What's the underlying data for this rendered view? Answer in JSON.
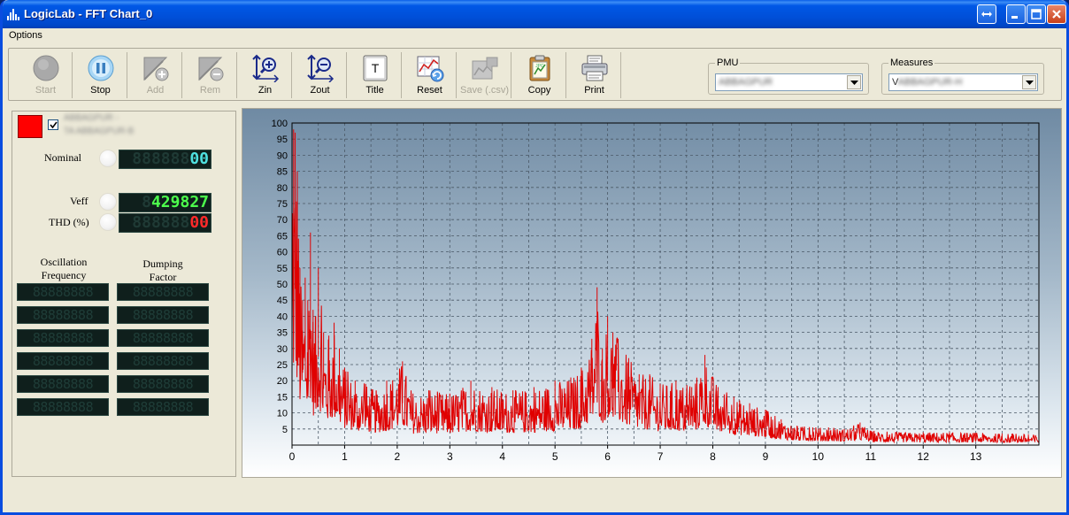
{
  "window": {
    "title": "LogicLab - FFT Chart_0"
  },
  "menu": {
    "options": "Options"
  },
  "toolbar": {
    "buttons": [
      {
        "label": "Start",
        "icon": "start-icon",
        "enabled": false
      },
      {
        "label": "Stop",
        "icon": "stop-icon",
        "enabled": true
      },
      {
        "label": "Add",
        "icon": "add-icon",
        "enabled": false
      },
      {
        "label": "Rem",
        "icon": "remove-icon",
        "enabled": false
      },
      {
        "label": "Zin",
        "icon": "zoom-in-icon",
        "enabled": true
      },
      {
        "label": "Zout",
        "icon": "zoom-out-icon",
        "enabled": true
      },
      {
        "label": "Title",
        "icon": "title-icon",
        "enabled": true
      },
      {
        "label": "Reset",
        "icon": "reset-icon",
        "enabled": true
      },
      {
        "label": "Save (.csv)",
        "icon": "save-csv-icon",
        "enabled": false
      },
      {
        "label": "Copy",
        "icon": "copy-icon",
        "enabled": true
      },
      {
        "label": "Print",
        "icon": "print-icon",
        "enabled": true
      }
    ],
    "pmu": {
      "label": "PMU",
      "value": "ABBAGPUR"
    },
    "measures": {
      "label": "Measures",
      "value_prefix": "V",
      "value_blurred": "ABBAGPUR-H"
    }
  },
  "left_panel": {
    "series_color": "#ff0000",
    "series_checked": true,
    "series_name_line1": "ABBAGPUR -",
    "series_name_line2": "TA ABBAGPUR-B",
    "nominal": {
      "label": "Nominal",
      "ghost": "888888",
      "value": "00"
    },
    "veff": {
      "label": "Veff",
      "ghost": "8",
      "value": "429827"
    },
    "thd": {
      "label": "THD (%)",
      "ghost": "888888",
      "value": "00"
    },
    "oscillation_header": "Oscillation Frequency",
    "damping_header": "Dumping Factor",
    "cell_placeholder": "88888888",
    "rows": 6
  },
  "colors": {
    "series": "#e00000",
    "lcd_cyan": "#4fe0e0",
    "lcd_green": "#4dff4d",
    "lcd_red": "#ff2a2a"
  },
  "chart_data": {
    "type": "line",
    "xlim": [
      0,
      14.2
    ],
    "ylim": [
      0,
      100
    ],
    "x_ticks": [
      0,
      1,
      2,
      3,
      4,
      5,
      6,
      7,
      8,
      9,
      10,
      11,
      12,
      13
    ],
    "y_ticks": [
      5,
      10,
      15,
      20,
      25,
      30,
      35,
      40,
      45,
      50,
      55,
      60,
      65,
      70,
      75,
      80,
      85,
      90,
      95,
      100
    ],
    "grid": true,
    "series": [
      {
        "color": "#e00000",
        "envelope": [
          [
            0.0,
            60
          ],
          [
            0.03,
            98
          ],
          [
            0.06,
            97
          ],
          [
            0.1,
            85
          ],
          [
            0.15,
            55
          ],
          [
            0.2,
            45
          ],
          [
            0.25,
            52
          ],
          [
            0.3,
            45
          ],
          [
            0.35,
            66
          ],
          [
            0.4,
            42
          ],
          [
            0.45,
            40
          ],
          [
            0.5,
            55
          ],
          [
            0.6,
            35
          ],
          [
            0.7,
            34
          ],
          [
            0.8,
            38
          ],
          [
            0.9,
            30
          ],
          [
            1.0,
            24
          ],
          [
            1.2,
            20
          ],
          [
            1.4,
            19
          ],
          [
            1.6,
            17
          ],
          [
            1.8,
            20
          ],
          [
            2.1,
            26
          ],
          [
            2.3,
            16
          ],
          [
            2.6,
            17
          ],
          [
            3.0,
            16
          ],
          [
            3.4,
            20
          ],
          [
            3.8,
            18
          ],
          [
            4.2,
            17
          ],
          [
            4.6,
            18
          ],
          [
            5.0,
            20
          ],
          [
            5.3,
            21
          ],
          [
            5.5,
            24
          ],
          [
            5.7,
            33
          ],
          [
            5.8,
            49
          ],
          [
            5.9,
            30
          ],
          [
            6.0,
            40
          ],
          [
            6.1,
            35
          ],
          [
            6.2,
            33
          ],
          [
            6.4,
            27
          ],
          [
            6.6,
            22
          ],
          [
            6.8,
            22
          ],
          [
            7.0,
            19
          ],
          [
            7.3,
            20
          ],
          [
            7.6,
            18
          ],
          [
            7.85,
            28
          ],
          [
            8.1,
            18
          ],
          [
            8.4,
            15
          ],
          [
            8.7,
            13
          ],
          [
            9.0,
            11
          ],
          [
            9.3,
            8
          ],
          [
            9.6,
            6
          ],
          [
            9.9,
            5.5
          ],
          [
            10.2,
            5.5
          ],
          [
            10.5,
            5
          ],
          [
            10.8,
            7
          ],
          [
            11.0,
            4.5
          ],
          [
            11.5,
            4
          ],
          [
            12.0,
            4
          ],
          [
            12.5,
            4
          ],
          [
            13.0,
            3.8
          ],
          [
            13.5,
            3.6
          ],
          [
            14.0,
            3.4
          ],
          [
            14.2,
            3.2
          ]
        ]
      }
    ]
  }
}
